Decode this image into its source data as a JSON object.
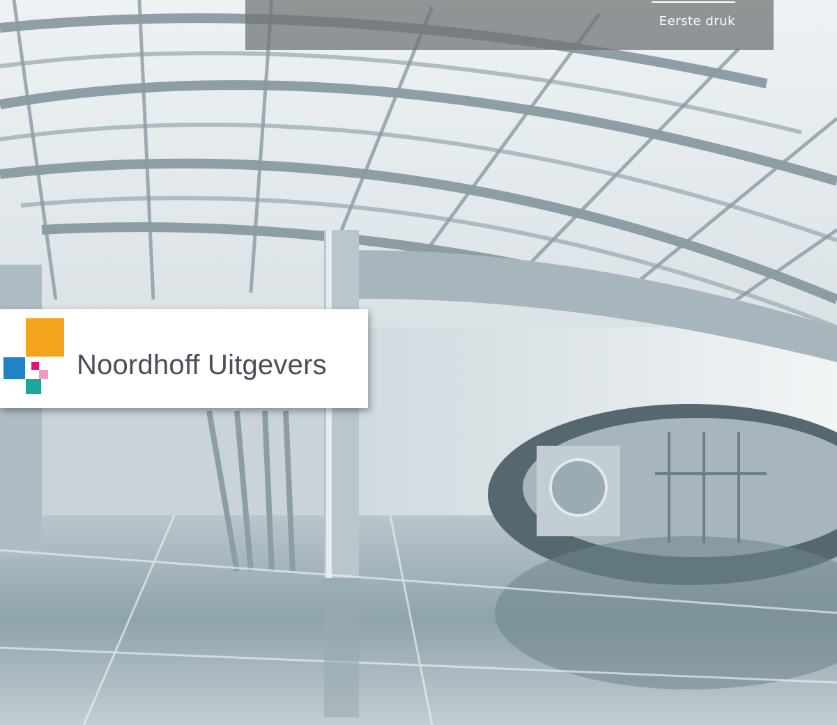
{
  "edition": {
    "label": "Eerste druk"
  },
  "publisher": {
    "name": "Noordhoff Uitgevers",
    "logo_colors": {
      "yellow": "#f4a41c",
      "blue": "#1f83c6",
      "magenta": "#e2136e",
      "pink": "#f49ac1",
      "teal": "#1ba89c"
    }
  },
  "background": {
    "description_icon": "glass-atrium-photo"
  }
}
